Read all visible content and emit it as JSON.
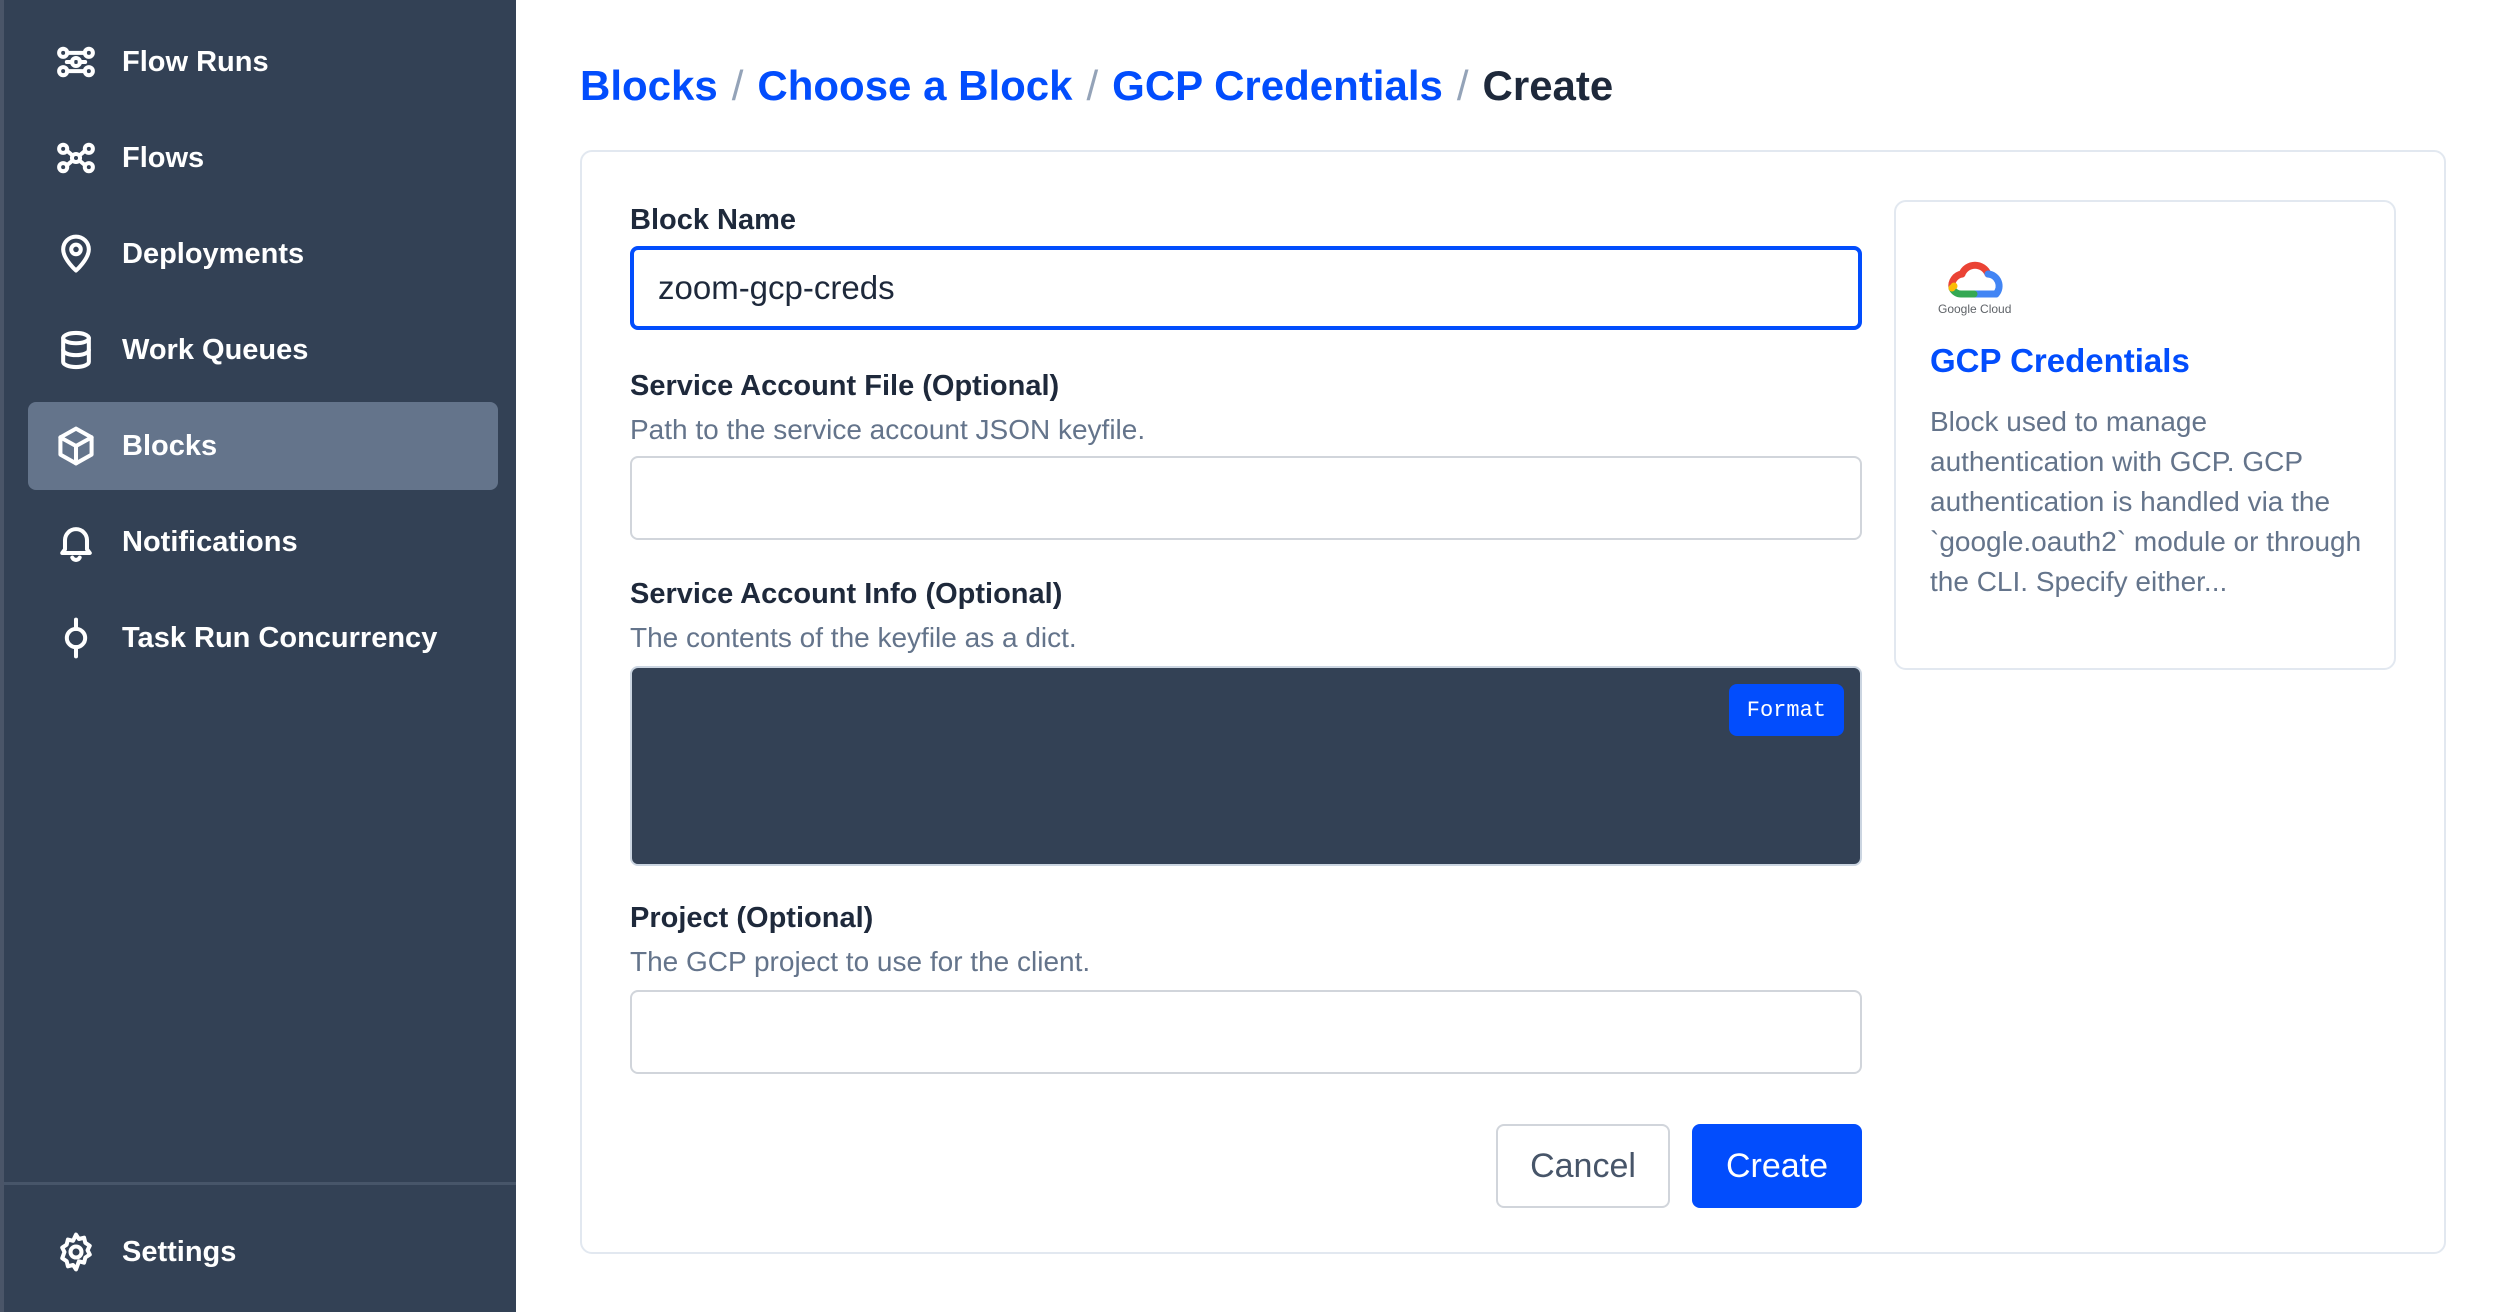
{
  "sidebar": {
    "items": [
      {
        "label": "Flow Runs",
        "icon": "flow-runs-icon"
      },
      {
        "label": "Flows",
        "icon": "flows-icon"
      },
      {
        "label": "Deployments",
        "icon": "location-pin-icon"
      },
      {
        "label": "Work Queues",
        "icon": "database-icon"
      },
      {
        "label": "Blocks",
        "icon": "cube-icon",
        "active": true
      },
      {
        "label": "Notifications",
        "icon": "bell-icon"
      },
      {
        "label": "Task Run Concurrency",
        "icon": "concurrency-icon"
      }
    ],
    "settings": {
      "label": "Settings",
      "icon": "gear-icon"
    }
  },
  "breadcrumb": {
    "items": [
      "Blocks",
      "Choose a Block",
      "GCP Credentials"
    ],
    "current": "Create",
    "separator": "/"
  },
  "form": {
    "block_name": {
      "label": "Block Name",
      "value": "zoom-gcp-creds"
    },
    "service_account_file": {
      "label": "Service Account File (Optional)",
      "description": "Path to the service account JSON keyfile.",
      "value": ""
    },
    "service_account_info": {
      "label": "Service Account Info (Optional)",
      "description": "The contents of the keyfile as a dict.",
      "format_label": "Format"
    },
    "project": {
      "label": "Project (Optional)",
      "description": "The GCP project to use for the client.",
      "value": ""
    },
    "cancel_label": "Cancel",
    "create_label": "Create"
  },
  "info_card": {
    "logo_text": "Google Cloud",
    "title": "GCP Credentials",
    "description": "Block used to manage authentication with GCP. GCP authentication is handled via the `google.oauth2` module or through the CLI. Specify either..."
  },
  "colors": {
    "sidebar_bg": "#334155",
    "accent": "#024dfd",
    "active_nav": "#64748b"
  }
}
